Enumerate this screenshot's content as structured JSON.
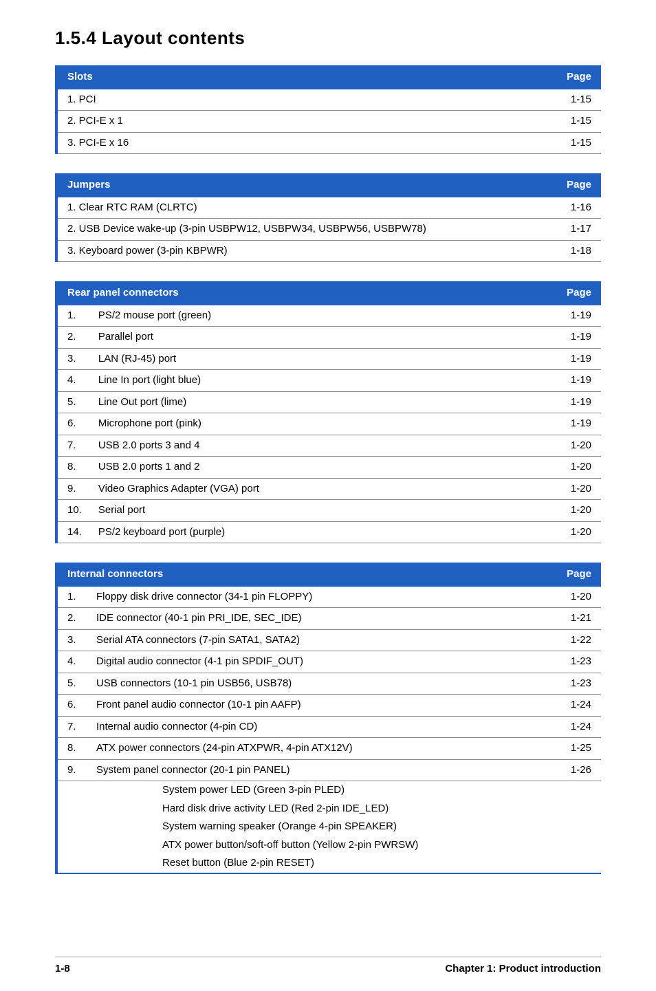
{
  "heading": "1.5.4   Layout contents",
  "slots": {
    "header_left": "Slots",
    "header_right": "Page",
    "rows": [
      {
        "label": "1.  PCI",
        "page": "1-15"
      },
      {
        "label": "2.  PCI-E x 1",
        "page": "1-15"
      },
      {
        "label": "3.  PCI-E x 16",
        "page": "1-15"
      }
    ]
  },
  "jumpers": {
    "header_left": "Jumpers",
    "header_right": "Page",
    "rows": [
      {
        "label": "1.  Clear RTC RAM (CLRTC)",
        "page": "1-16"
      },
      {
        "label": "2.  USB Device wake-up (3-pin USBPW12, USBPW34, USBPW56, USBPW78)",
        "page": "1-17"
      },
      {
        "label": "3.  Keyboard power (3-pin KBPWR)",
        "page": "1-18"
      }
    ]
  },
  "rear_panel": {
    "header_left": "Rear panel connectors",
    "header_right": "Page",
    "rows": [
      {
        "num": "1.",
        "label": "PS/2 mouse port (green)",
        "page": "1-19"
      },
      {
        "num": "2.",
        "label": "Parallel port",
        "page": "1-19"
      },
      {
        "num": "3.",
        "label": "LAN (RJ-45) port",
        "page": "1-19"
      },
      {
        "num": "4.",
        "label": "Line In port (light blue)",
        "page": "1-19"
      },
      {
        "num": "5.",
        "label": "Line Out port (lime)",
        "page": "1-19"
      },
      {
        "num": "6.",
        "label": "Microphone port (pink)",
        "page": "1-19"
      },
      {
        "num": "7.",
        "label": "USB 2.0 ports 3 and 4",
        "page": "1-20"
      },
      {
        "num": "8.",
        "label": "USB 2.0 ports 1 and 2",
        "page": "1-20"
      },
      {
        "num": "9.",
        "label": "Video Graphics Adapter (VGA) port",
        "page": "1-20"
      },
      {
        "num": "10.",
        "label": "Serial port",
        "page": "1-20"
      },
      {
        "num": "14.",
        "label": "PS/2 keyboard port (purple)",
        "page": "1-20"
      }
    ]
  },
  "internal": {
    "header_left": "Internal connectors",
    "header_right": "Page",
    "rows": [
      {
        "num": "1.",
        "label": "Floppy disk drive connector (34-1 pin FLOPPY)",
        "page": "1-20"
      },
      {
        "num": "2.",
        "label": "IDE connector (40-1 pin PRI_IDE, SEC_IDE)",
        "page": "1-21"
      },
      {
        "num": "3.",
        "label": "Serial ATA connectors (7-pin SATA1, SATA2)",
        "page": "1-22"
      },
      {
        "num": "4.",
        "label": "Digital audio connector (4-1 pin SPDIF_OUT)",
        "page": "1-23"
      },
      {
        "num": "5.",
        "label": "USB connectors (10-1 pin USB56, USB78)",
        "page": "1-23"
      },
      {
        "num": "6.",
        "label": "Front panel audio connector (10-1 pin AAFP)",
        "page": "1-24"
      },
      {
        "num": "7.",
        "label": "Internal audio connector (4-pin CD)",
        "page": "1-24"
      },
      {
        "num": "8.",
        "label": "ATX power connectors (24-pin ATXPWR, 4-pin ATX12V)",
        "page": "1-25"
      },
      {
        "num": "9.",
        "label": "System panel connector (20-1 pin PANEL)",
        "page": "1-26"
      }
    ],
    "sub_items": [
      "System power LED (Green 3-pin PLED)",
      "Hard disk drive activity LED (Red 2-pin IDE_LED)",
      "System warning speaker (Orange 4-pin SPEAKER)",
      "ATX power button/soft-off button (Yellow 2-pin PWRSW)",
      "Reset button (Blue 2-pin RESET)"
    ]
  },
  "footer": {
    "page_number": "1-8",
    "chapter": "Chapter 1: Product introduction"
  }
}
